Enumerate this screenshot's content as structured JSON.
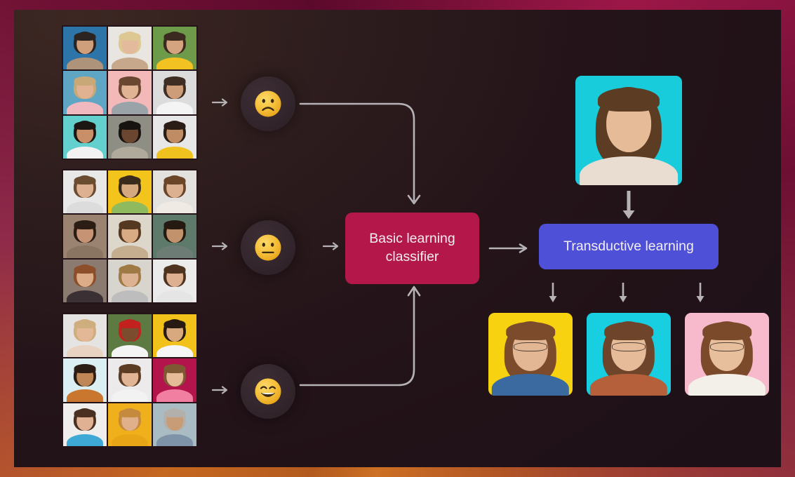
{
  "diagram": {
    "title": "Transductive learning pipeline",
    "background": {
      "frame_gradient": [
        "#b35a1f",
        "#c4671f",
        "#8f2a4a",
        "#6e1033",
        "#5c0a2c",
        "#9c1747",
        "#b05426",
        "#cc7024"
      ],
      "stage_color": "#241419"
    },
    "connector_color": "#b6b2b6",
    "accent_colors": {
      "classifier": "#b4184b",
      "transductive": "#4f50d8",
      "emoji_node": "#33262c",
      "emoji_yellow": "#f6c344"
    }
  },
  "input_groups": [
    {
      "name": "angry-faces-grid",
      "emoji": "frowning-face",
      "emoji_label": "Frowning face",
      "arrow_label": "feeds into",
      "photos": [
        {
          "bg": "#2d74a8",
          "hair": "#2b2420",
          "skin": "#cf9f7c",
          "cloth": "#ad9379"
        },
        {
          "bg": "#e9e6e1",
          "hair": "#ddc893",
          "skin": "#e3bb9c",
          "cloth": "#c8a88a"
        },
        {
          "bg": "#6e9b4a",
          "hair": "#3a2a1f",
          "skin": "#d3a47f",
          "cloth": "#f2c222"
        },
        {
          "bg": "#5fa6c4",
          "hair": "#c9a878",
          "skin": "#e0b292",
          "cloth": "#f0b9c0"
        },
        {
          "bg": "#f3b9b8",
          "hair": "#6a4730",
          "skin": "#e0b394",
          "cloth": "#9aa3a8"
        },
        {
          "bg": "#dcdcdc",
          "hair": "#3d2d22",
          "skin": "#cd9c78",
          "cloth": "#f4f4f4"
        },
        {
          "bg": "#63d0cd",
          "hair": "#1d1714",
          "skin": "#c98f68",
          "cloth": "#f2f2f2"
        },
        {
          "bg": "#8f8e84",
          "hair": "#171310",
          "skin": "#6a4630",
          "cloth": "#b0aa9c"
        },
        {
          "bg": "#e7e7e7",
          "hair": "#2a1d16",
          "skin": "#c08c64",
          "cloth": "#f0c21f"
        }
      ]
    },
    {
      "name": "neutral-faces-grid",
      "emoji": "neutral-face",
      "emoji_label": "Neutral face",
      "arrow_label": "feeds into",
      "photos": [
        {
          "bg": "#e8e8e8",
          "hair": "#6a4c31",
          "skin": "#dcb091",
          "cloth": "#dcdcdc"
        },
        {
          "bg": "#f2c41c",
          "hair": "#3a2a1c",
          "skin": "#d6a87f",
          "cloth": "#8fba5d"
        },
        {
          "bg": "#e4e2de",
          "hair": "#6b4528",
          "skin": "#dcb191",
          "cloth": "#efeae4"
        },
        {
          "bg": "#9a8370",
          "hair": "#2b1d14",
          "skin": "#c69474",
          "cloth": "#8a7562"
        },
        {
          "bg": "#ddd6cb",
          "hair": "#54381f",
          "skin": "#d9ab85",
          "cloth": "#c5ae90"
        },
        {
          "bg": "#5e7a6b",
          "hair": "#241a12",
          "skin": "#c2926c",
          "cloth": "#6d7d75"
        },
        {
          "bg": "#8a7a70",
          "hair": "#8d4f2a",
          "skin": "#dcab88",
          "cloth": "#3b3034"
        },
        {
          "bg": "#d8d5cf",
          "hair": "#a07a44",
          "skin": "#dcb292",
          "cloth": "#bdbdbd"
        },
        {
          "bg": "#ebebeb",
          "hair": "#4e3320",
          "skin": "#dcb091",
          "cloth": "#e5e5e5"
        }
      ]
    },
    {
      "name": "happy-faces-grid",
      "emoji": "grinning-face",
      "emoji_label": "Grinning face",
      "arrow_label": "feeds into",
      "photos": [
        {
          "bg": "#e6e4e2",
          "hair": "#cfae7d",
          "skin": "#e3b896",
          "cloth": "#e8d3c2"
        },
        {
          "bg": "#5d7a42",
          "hair": "#c2211d",
          "skin": "#7b4c2d",
          "cloth": "#f4f4f4"
        },
        {
          "bg": "#f3c21a",
          "hair": "#261a12",
          "skin": "#d8a87e",
          "cloth": "#f6f6f6"
        },
        {
          "bg": "#dbeef1",
          "hair": "#2b1d14",
          "skin": "#c08756",
          "cloth": "#c9762e"
        },
        {
          "bg": "#eceaea",
          "hair": "#5c3c22",
          "skin": "#e0b494",
          "cloth": "#f2f2f2"
        },
        {
          "bg": "#b4144c",
          "hair": "#7e5832",
          "skin": "#e5bb98",
          "cloth": "#f07fa2"
        },
        {
          "bg": "#f0eeec",
          "hair": "#4a3020",
          "skin": "#e0b192",
          "cloth": "#3fa9d6"
        },
        {
          "bg": "#efb01c",
          "hair": "#c58a3e",
          "skin": "#dfb08a",
          "cloth": "#e8a516"
        },
        {
          "bg": "#a9bcc4",
          "hair": "#b3b0ac",
          "skin": "#c79c77",
          "cloth": "#7f93a8"
        }
      ]
    }
  ],
  "nodes": {
    "classifier": {
      "label": "Basic learning\nclassifier",
      "line1": "Basic learning",
      "line2": "classifier"
    },
    "transductive": {
      "label": "Transductive learning"
    }
  },
  "target": {
    "name": "target-photo",
    "bg": "#18ccdc",
    "hair": "#5d3c24",
    "skin": "#e6bb98",
    "cloth": "#e8ddd0"
  },
  "outputs": [
    {
      "name": "output-photo-yellow",
      "bg": "#f6d211",
      "hair": "#7b4b2c",
      "skin": "#e3b694",
      "cloth": "#3a6aa0",
      "glasses": true
    },
    {
      "name": "output-photo-cyan",
      "bg": "#17cfe0",
      "hair": "#6e452a",
      "skin": "#e5bb9a",
      "cloth": "#b5603a",
      "glasses": true
    },
    {
      "name": "output-photo-pink",
      "bg": "#f7b9cc",
      "hair": "#7a4a2b",
      "skin": "#e8bf9d",
      "cloth": "#f3f0ea",
      "glasses": true
    }
  ],
  "arrows": {
    "grid_to_emoji": "arrow-right",
    "emoji_to_classifier": "arrow-right",
    "classifier_to_transductive": "arrow-right",
    "target_to_transductive": "arrow-down",
    "transductive_to_outputs": "arrow-down",
    "elbow_top": "elbow-down",
    "elbow_bottom": "elbow-up"
  }
}
